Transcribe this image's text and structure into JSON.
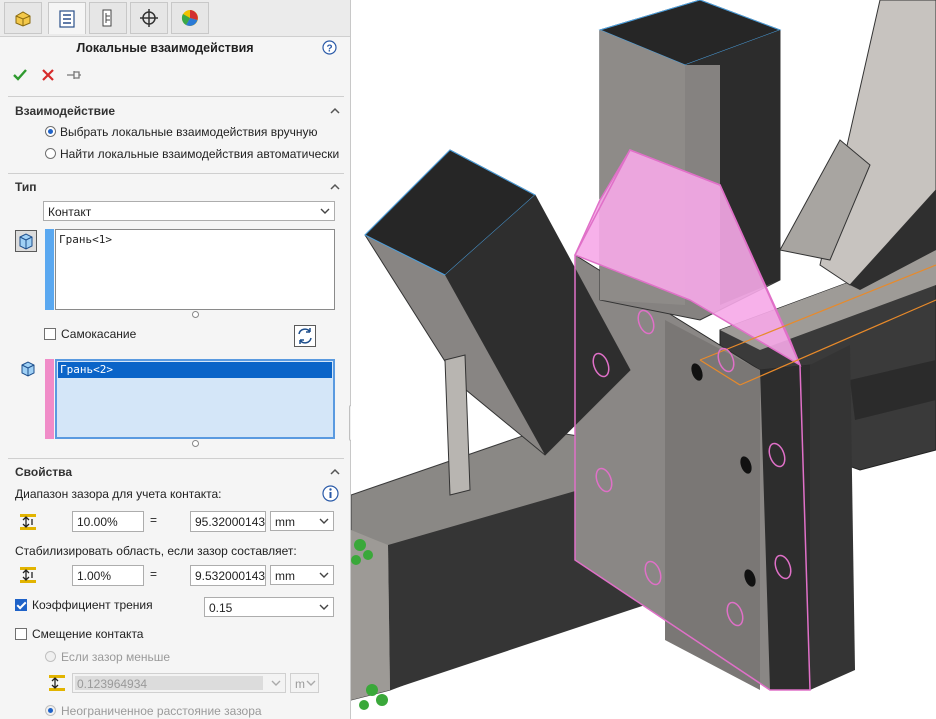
{
  "tabs": [
    {
      "icon": "feature-manager-icon"
    },
    {
      "icon": "property-manager-icon"
    },
    {
      "icon": "configuration-manager-icon"
    },
    {
      "icon": "dimxpert-icon"
    },
    {
      "icon": "display-manager-icon"
    }
  ],
  "header": {
    "title": "Локальные взаимодействия",
    "help_icon": "help-icon"
  },
  "actions": {
    "ok_icon": "check-icon",
    "cancel_icon": "close-icon",
    "pin_icon": "pushpin-icon"
  },
  "interaction": {
    "heading": "Взаимодействие",
    "option_manual": "Выбрать локальные взаимодействия вручную",
    "option_auto": "Найти локальные взаимодействия автоматически",
    "selected": "manual"
  },
  "type": {
    "heading": "Тип",
    "selected": "Контакт",
    "set1": {
      "item": "Грань<1>",
      "color": "#5aa8f0"
    },
    "self_contact_label": "Самокасание",
    "self_contact_checked": false,
    "set2": {
      "item": "Грань<2>",
      "color": "#f08cc8"
    }
  },
  "properties": {
    "heading": "Свойства",
    "gap_range_label": "Диапазон зазора для учета контакта:",
    "gap_percent": "10.00%",
    "gap_equals": "=",
    "gap_value": "95.32000143",
    "gap_unit": "mm",
    "stabilize_label": "Стабилизировать область, если зазор составляет:",
    "stabilize_percent": "1.00%",
    "stabilize_equals": "=",
    "stabilize_value": "9.532000143",
    "stabilize_unit": "mm",
    "friction_label": "Коэффициент трения",
    "friction_checked": true,
    "friction_value": "0.15",
    "offset_label": "Смещение контакта",
    "offset_checked": false,
    "if_gap_less_label": "Если зазор меньше",
    "if_gap_less_value": "0.123964934",
    "if_gap_less_unit": "m",
    "unlimited_label": "Неограниченное расстояние зазора"
  },
  "colors": {
    "accent": "#1e62c8",
    "selection": "#0a64c8",
    "model_gray": "#8c8c8c",
    "highlight_pink": "#f6a8e8"
  }
}
